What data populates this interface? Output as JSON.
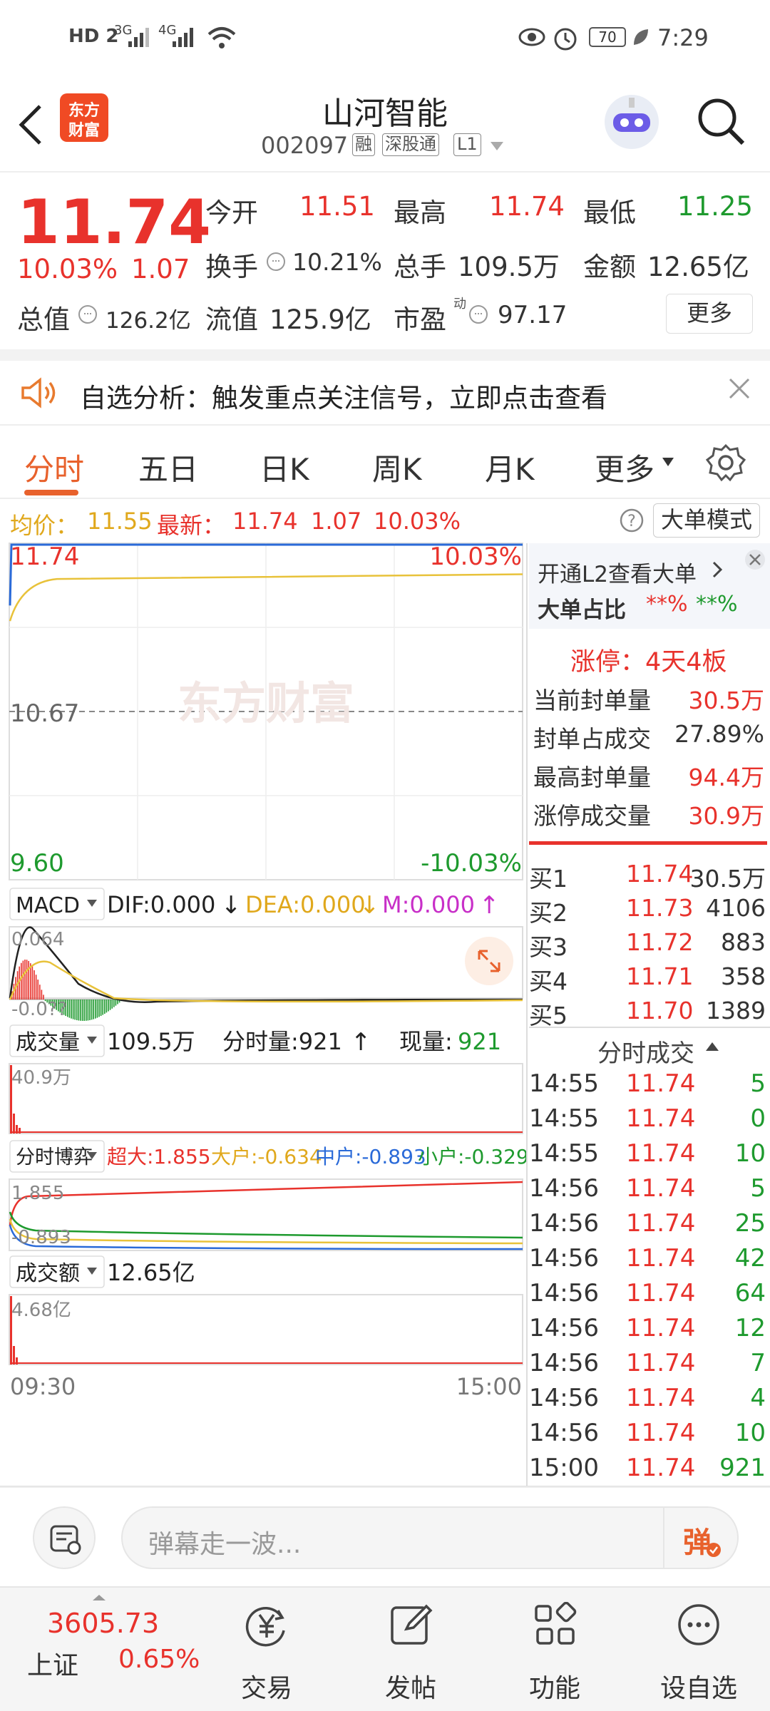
{
  "status_bar": {
    "left": [
      "HD 2",
      "3G",
      "4G"
    ],
    "battery": "70",
    "time": "7:29"
  },
  "header": {
    "logo_line1": "东方",
    "logo_line2": "财富",
    "title": "山河智能",
    "code": "002097",
    "tags": [
      "融",
      "深股通",
      "L1"
    ]
  },
  "quote": {
    "price": "11.74",
    "change_pct": "10.03%",
    "change": "1.07",
    "open_label": "今开",
    "open": "11.51",
    "high_label": "最高",
    "high": "11.74",
    "low_label": "最低",
    "low": "11.25",
    "turnover_label": "换手",
    "turnover": "10.21%",
    "volume_label": "总手",
    "volume": "109.5万",
    "amount_label": "金额",
    "amount": "12.65亿",
    "mktcap_label": "总值",
    "mktcap": "126.2亿",
    "float_label": "流值",
    "float": "125.9亿",
    "pe_label": "市盈",
    "pe_sup": "动",
    "pe": "97.17",
    "more_button": "更多"
  },
  "notice": {
    "text": "自选分析：触发重点关注信号，立即点击查看"
  },
  "tabs": [
    "分时",
    "五日",
    "日K",
    "周K",
    "月K",
    "更多"
  ],
  "infobar": {
    "avg_label": "均价：",
    "avg": "11.55",
    "latest_label": "最新：",
    "latest": "11.74",
    "chg": "1.07",
    "pct": "10.03%",
    "mode_button": "大单模式"
  },
  "chart": {
    "price_top": "11.74",
    "pct_top": "10.03%",
    "price_mid": "10.67",
    "price_bottom": "9.60",
    "pct_bottom": "-10.03%",
    "watermark": "东方财富",
    "macd_select": "MACD",
    "dif": "DIF:0.000",
    "dea": "DEA:0.000",
    "m": "M:0.000",
    "macd_top": "0.064",
    "macd_bottom": "-0.0??",
    "vol_select": "成交量",
    "vol_total": "109.5万",
    "vol_min_label": "分时量:921",
    "vol_now_label": "现量:",
    "vol_now": "921",
    "vol_max": "40.9万",
    "game_select": "分时博弈",
    "super_label": "超大:1.855",
    "big_label": "大户:-0.634",
    "mid_label": "中户:-0.893",
    "small_label": "小户:-0.329",
    "game_top": "1.855",
    "game_bottom": "-0.893",
    "amt_select": "成交额",
    "amt_total": "12.65亿",
    "amt_max": "4.68亿",
    "time_start": "09:30",
    "time_end": "15:00"
  },
  "chart_data": [
    {
      "type": "line",
      "title": "",
      "x": [
        "09:30",
        "15:00"
      ],
      "series": [
        {
          "name": "",
          "values": [
            11.74,
            11.74
          ]
        },
        {
          "name": "均价",
          "values": [
            11.25,
            11.55
          ]
        }
      ],
      "ylim": [
        9.6,
        11.74
      ]
    },
    {
      "type": "bar",
      "title": "",
      "ylim": [
        0,
        40.9
      ]
    }
  ],
  "side": {
    "l2_link": "开通L2查看大单",
    "big_ratio_label": "大单占比",
    "big_ratio_red": "**%",
    "big_ratio_green": "**%",
    "limit_up": "涨停：4天4板",
    "rows": [
      {
        "label": "当前封单量",
        "value": "30.5万"
      },
      {
        "label": "封单占成交",
        "value": "27.89%"
      },
      {
        "label": "最高封单量",
        "value": "94.4万"
      },
      {
        "label": "涨停成交量",
        "value": "30.9万"
      }
    ],
    "book": [
      {
        "label": "买1",
        "price": "11.74",
        "vol": "30.5万"
      },
      {
        "label": "买2",
        "price": "11.73",
        "vol": "4106"
      },
      {
        "label": "买3",
        "price": "11.72",
        "vol": "883"
      },
      {
        "label": "买4",
        "price": "11.71",
        "vol": "358"
      },
      {
        "label": "买5",
        "price": "11.70",
        "vol": "1389"
      }
    ],
    "ticks_title": "分时成交",
    "ticks": [
      {
        "t": "14:55",
        "p": "11.74",
        "v": "5"
      },
      {
        "t": "14:55",
        "p": "11.74",
        "v": "0"
      },
      {
        "t": "14:55",
        "p": "11.74",
        "v": "10"
      },
      {
        "t": "14:56",
        "p": "11.74",
        "v": "5"
      },
      {
        "t": "14:56",
        "p": "11.74",
        "v": "25"
      },
      {
        "t": "14:56",
        "p": "11.74",
        "v": "42"
      },
      {
        "t": "14:56",
        "p": "11.74",
        "v": "64"
      },
      {
        "t": "14:56",
        "p": "11.74",
        "v": "12"
      },
      {
        "t": "14:56",
        "p": "11.74",
        "v": "7"
      },
      {
        "t": "14:56",
        "p": "11.74",
        "v": "4"
      },
      {
        "t": "14:56",
        "p": "11.74",
        "v": "10"
      },
      {
        "t": "15:00",
        "p": "11.74",
        "v": "921"
      }
    ]
  },
  "chat": {
    "placeholder": "弹幕走一波...",
    "danmu_button": "弹"
  },
  "nav": {
    "index_value": "3605.73",
    "index_name": "上证",
    "index_pct": "0.65%",
    "items": [
      "交易",
      "发帖",
      "功能",
      "设自选"
    ]
  }
}
